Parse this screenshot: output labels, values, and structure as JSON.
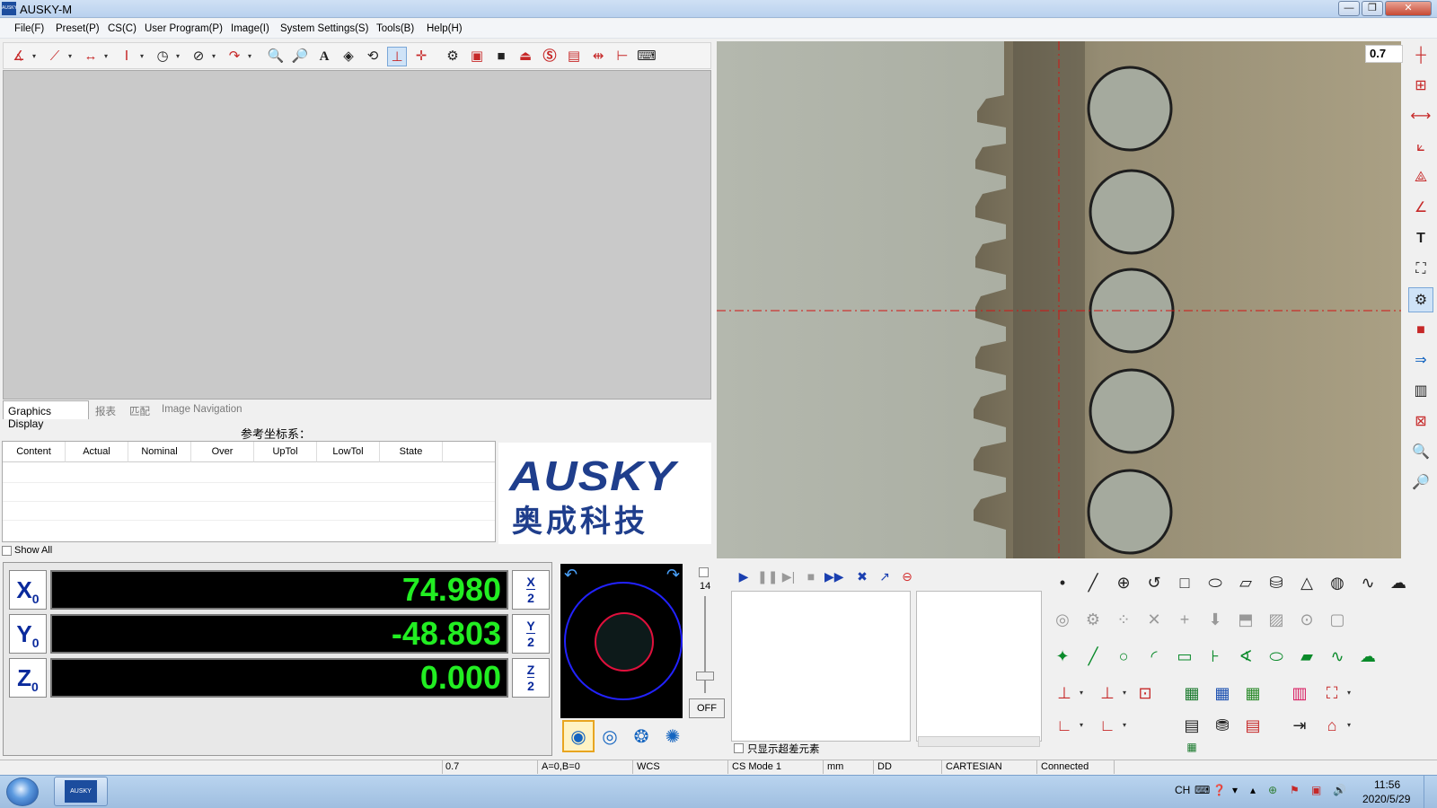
{
  "window": {
    "title": "AUSKY-M",
    "icon_text": "AUSKY"
  },
  "menu": [
    "File(F)",
    "Preset(P)",
    "CS(C)",
    "User Program(P)",
    "Image(I)",
    "System Settings(S)",
    "Tools(B)",
    "Help(H)"
  ],
  "left_tabs": [
    "Graphics Display",
    "报表",
    "匹配",
    "Image Navigation"
  ],
  "ref_cs_label": "参考坐标系：",
  "table": {
    "headers": [
      "Content",
      "Actual",
      "Nominal",
      "Over",
      "UpTol",
      "LowTol",
      "State"
    ]
  },
  "logo": {
    "en": "AUSKY",
    "cn": "奥成科技"
  },
  "show_all": "Show All",
  "dro": {
    "x": {
      "label": "X",
      "sub": "0",
      "value": "74.980",
      "half_top": "X",
      "half_bot": "2"
    },
    "y": {
      "label": "Y",
      "sub": "0",
      "value": "-48.803",
      "half_top": "Y",
      "half_bot": "2"
    },
    "z": {
      "label": "Z",
      "sub": "0",
      "value": "0.000",
      "half_top": "Z",
      "half_bot": "2"
    }
  },
  "light": {
    "level": "14",
    "off_label": "OFF"
  },
  "only_out_of_tol": "只显示超差元素",
  "camera": {
    "zoom": "0.7"
  },
  "status": {
    "zoom": "0.7",
    "angles": "A=0,B=0",
    "cs": "WCS",
    "cs_mode": "CS Mode 1",
    "unit": "mm",
    "angle_fmt": "DD",
    "coord": "CARTESIAN",
    "conn": "Connected"
  },
  "taskbar": {
    "lang": "CH",
    "time": "11:56",
    "date": "2020/5/29"
  },
  "colors": {
    "dro_text": "#22ee22",
    "logo": "#1f3e8c",
    "accent_red": "#c62828",
    "axis_blue": "#0a2a9c"
  }
}
